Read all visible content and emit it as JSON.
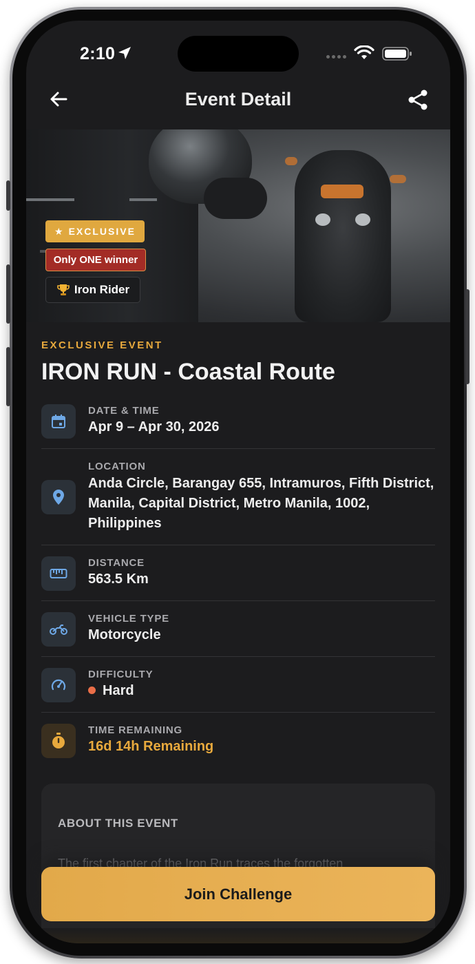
{
  "status_bar": {
    "time": "2:10"
  },
  "nav": {
    "title": "Event Detail"
  },
  "hero": {
    "badge_exclusive": "EXCLUSIVE",
    "badge_winner": "Only ONE winner",
    "badge_title": "Iron Rider"
  },
  "event": {
    "kicker": "EXCLUSIVE EVENT",
    "title": "IRON RUN - Coastal Route"
  },
  "details": {
    "date": {
      "label": "DATE & TIME",
      "value": "Apr 9 – Apr 30, 2026",
      "icon": "calendar-icon"
    },
    "location": {
      "label": "LOCATION",
      "value": "Anda Circle, Barangay 655, Intramuros, Fifth District, Manila, Capital District, Metro Manila, 1002, Philippines",
      "icon": "location-pin-icon"
    },
    "distance": {
      "label": "DISTANCE",
      "value": "563.5 Km",
      "icon": "ruler-icon"
    },
    "vehicle": {
      "label": "VEHICLE TYPE",
      "value": "Motorcycle",
      "icon": "motorcycle-icon"
    },
    "difficulty": {
      "label": "DIFFICULTY",
      "value": "Hard",
      "icon": "speedometer-icon",
      "dot_color": "#ea6e48"
    },
    "time_remaining": {
      "label": "TIME REMAINING",
      "value": "16d 14h Remaining",
      "icon": "stopwatch-icon",
      "color": "#e8a93d"
    }
  },
  "about": {
    "label": "ABOUT THIS EVENT",
    "text": "The first chapter of the Iron Run traces the forgotten"
  },
  "cta": {
    "label": "Join Challenge"
  },
  "colors": {
    "accent": "#e8a93d",
    "background": "#1c1c1e",
    "icon_blue": "#6ea8e6"
  }
}
